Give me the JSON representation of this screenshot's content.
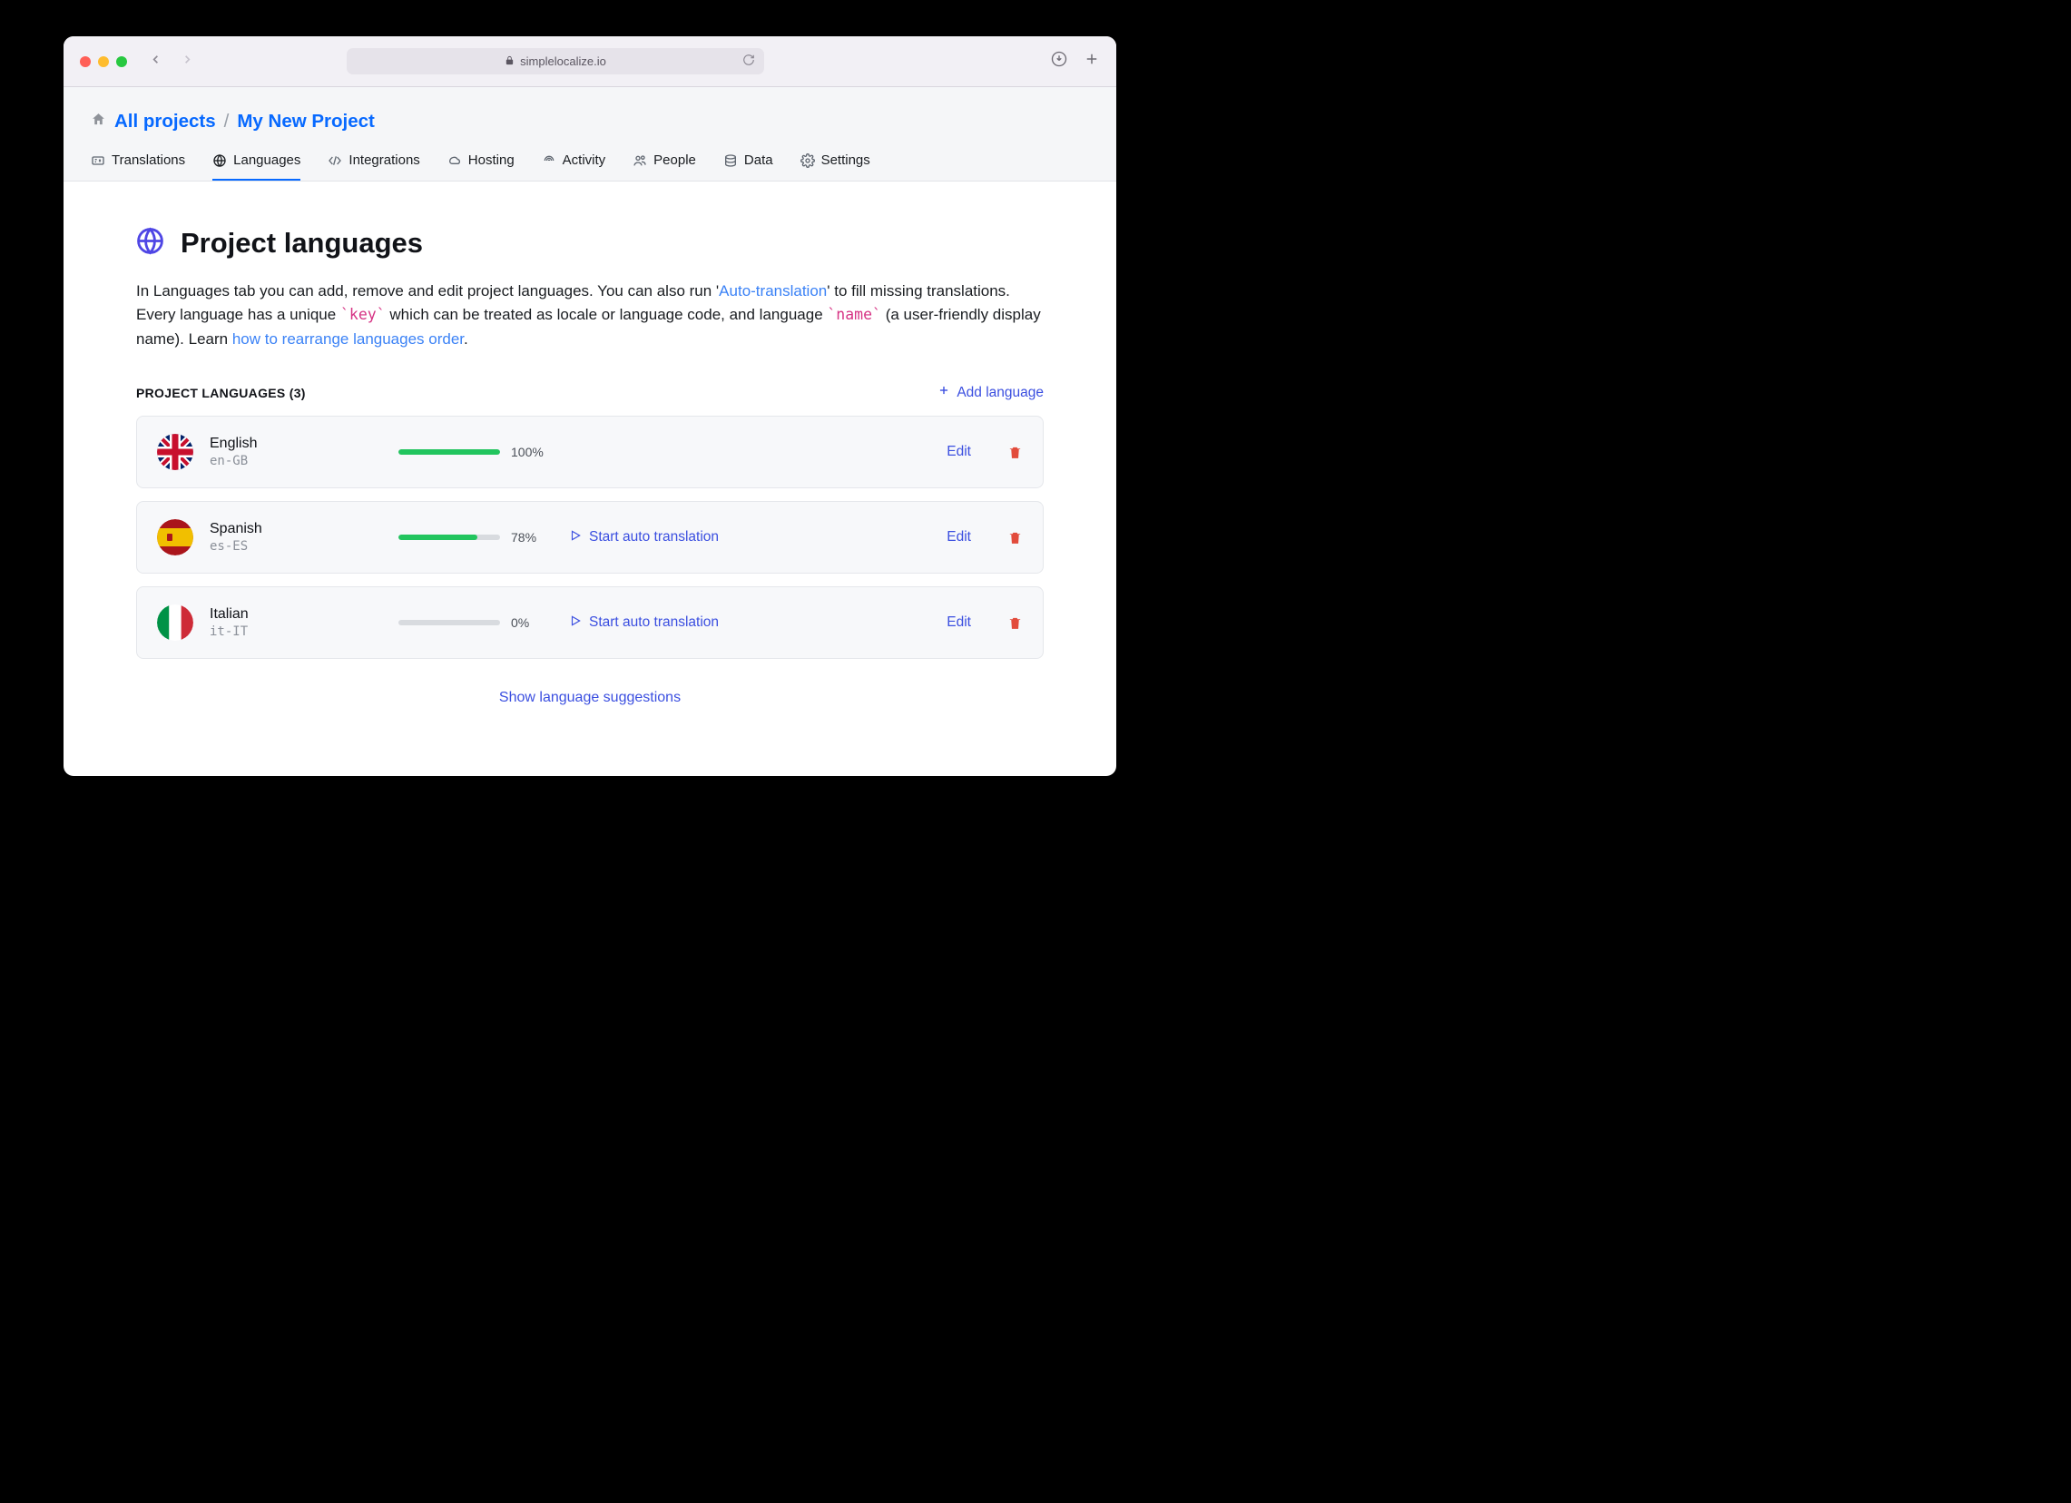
{
  "browser": {
    "url": "simplelocalize.io"
  },
  "breadcrumb": {
    "all_projects": "All projects",
    "separator": "/",
    "current": "My New Project"
  },
  "tabs": [
    {
      "id": "translations",
      "label": "Translations"
    },
    {
      "id": "languages",
      "label": "Languages"
    },
    {
      "id": "integrations",
      "label": "Integrations"
    },
    {
      "id": "hosting",
      "label": "Hosting"
    },
    {
      "id": "activity",
      "label": "Activity"
    },
    {
      "id": "people",
      "label": "People"
    },
    {
      "id": "data",
      "label": "Data"
    },
    {
      "id": "settings",
      "label": "Settings"
    }
  ],
  "active_tab": "languages",
  "page": {
    "title": "Project languages",
    "description_parts": {
      "p1": "In Languages tab you can add, remove and edit project languages. You can also run '",
      "link1": "Auto-translation",
      "p2": "' to fill missing translations. Every language has a unique ",
      "code1": "`key`",
      "p3": " which can be treated as locale or language code, and language ",
      "code2": "`name`",
      "p4": " (a user-friendly display name). Learn ",
      "link2": "how to rearrange languages order",
      "p5": "."
    }
  },
  "list": {
    "header_label": "PROJECT LANGUAGES (3)",
    "add_label": "Add language",
    "edit_label": "Edit",
    "auto_label": "Start auto translation",
    "suggestions_label": "Show language suggestions"
  },
  "languages": [
    {
      "name": "English",
      "key": "en-GB",
      "percent": 100,
      "percent_label": "100%",
      "show_auto": false,
      "flag": "gb"
    },
    {
      "name": "Spanish",
      "key": "es-ES",
      "percent": 78,
      "percent_label": "78%",
      "show_auto": true,
      "flag": "es"
    },
    {
      "name": "Italian",
      "key": "it-IT",
      "percent": 0,
      "percent_label": "0%",
      "show_auto": true,
      "flag": "it"
    }
  ]
}
